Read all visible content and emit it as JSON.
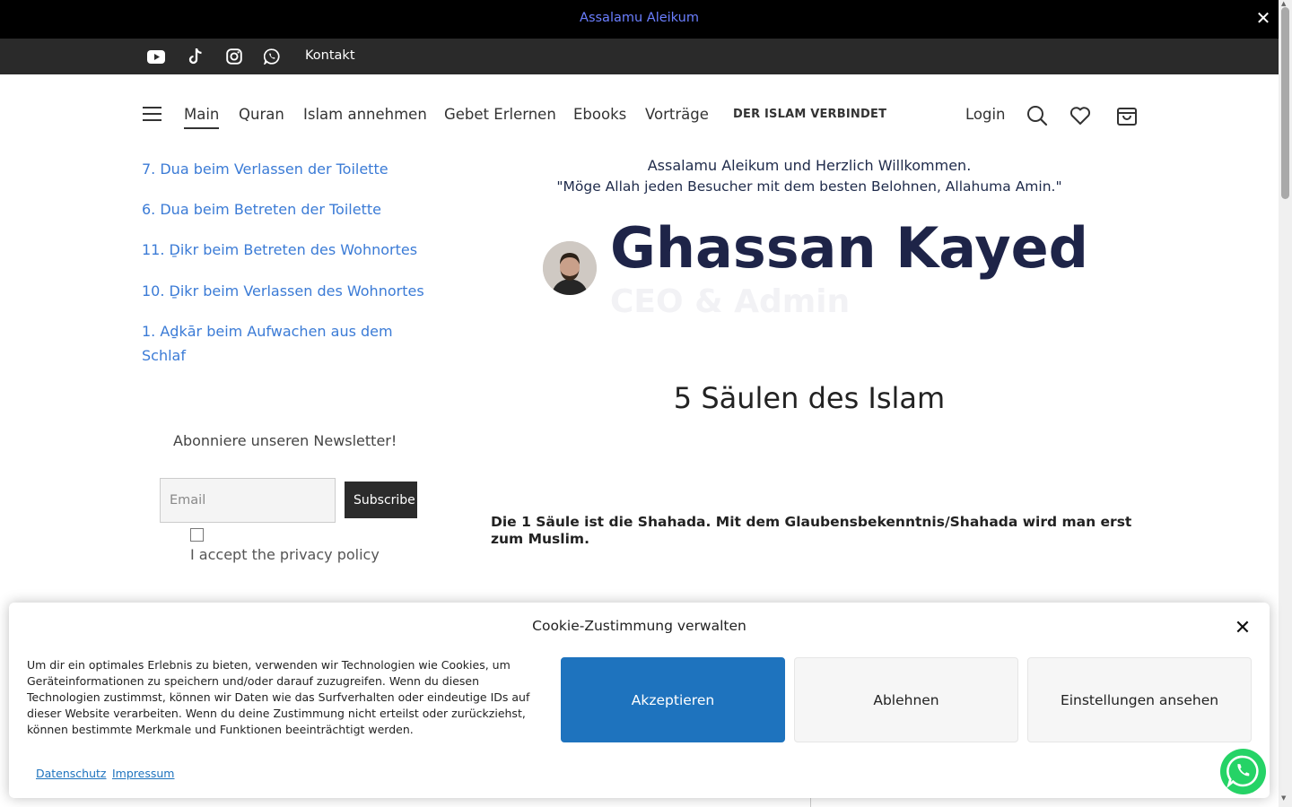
{
  "announcement": {
    "text": "Assalamu Aleikum",
    "close_icon": "✕"
  },
  "social_bar": {
    "icons": [
      "youtube-icon",
      "tiktok-icon",
      "instagram-icon",
      "whatsapp-icon"
    ],
    "contact_label": "Kontakt"
  },
  "nav": {
    "items": [
      {
        "label": "Main",
        "active": true
      },
      {
        "label": "Quran"
      },
      {
        "label": "Islam annehmen"
      },
      {
        "label": "Gebet Erlernen"
      },
      {
        "label": "Ebooks"
      },
      {
        "label": "Vorträge"
      }
    ],
    "brand": "DER ISLAM VERBINDET",
    "login": "Login",
    "icons": [
      "search-icon",
      "heart-icon",
      "shopping-bag-icon"
    ]
  },
  "sidebar": {
    "links": [
      "7. Dua beim Verlassen der Toilette",
      "6. Dua beim Betreten der Toilette",
      "11. Ḏikr beim Betreten des Wohnortes",
      "10. Ḏikr beim Verlassen des Wohnortes",
      "1. Aḏkār beim Aufwachen aus dem Schlaf"
    ],
    "newsletter": {
      "title": "Abonniere unseren Newsletter!",
      "email_placeholder": "Email",
      "subscribe_label": "Subscribe",
      "privacy_label": "I accept the privacy policy"
    }
  },
  "main": {
    "welcome_line1": "Assalamu Aleikum und Herzlich Willkommen.",
    "welcome_line2": "\"Möge Allah jeden Besucher mit dem besten Belohnen, Allahuma Amin.\"",
    "author": {
      "name": "Ghassan Kayed",
      "role": "CEO & Admin"
    },
    "section_title": "5 Säulen des Islam",
    "pillar_text": "Die 1  Säule ist die Shahada. Mit dem Glaubensbekenntnis/Shahada wird man erst zum Muslim."
  },
  "cookie": {
    "title": "Cookie-Zustimmung verwalten",
    "text": "Um dir ein optimales Erlebnis zu bieten, verwenden wir Technologien wie Cookies, um Geräteinformationen zu speichern und/oder darauf zuzugreifen. Wenn du diesen Technologien zustimmst, können wir Daten wie das Surfverhalten oder eindeutige IDs auf dieser Website verarbeiten. Wenn du deine Zustimmung nicht erteilst oder zurückziehst, können bestimmte Merkmale und Funktionen beeinträchtigt werden.",
    "accept": "Akzeptieren",
    "deny": "Ablehnen",
    "settings": "Einstellungen ansehen",
    "links": [
      "Datenschutz",
      "Impressum"
    ],
    "close_icon": "✕"
  },
  "colors": {
    "accent_blue": "#1e73be",
    "link_blue": "#3b7bd6",
    "announce_text": "#6b7fff",
    "author_name": "#1e2448",
    "whatsapp_green": "#25d366"
  }
}
